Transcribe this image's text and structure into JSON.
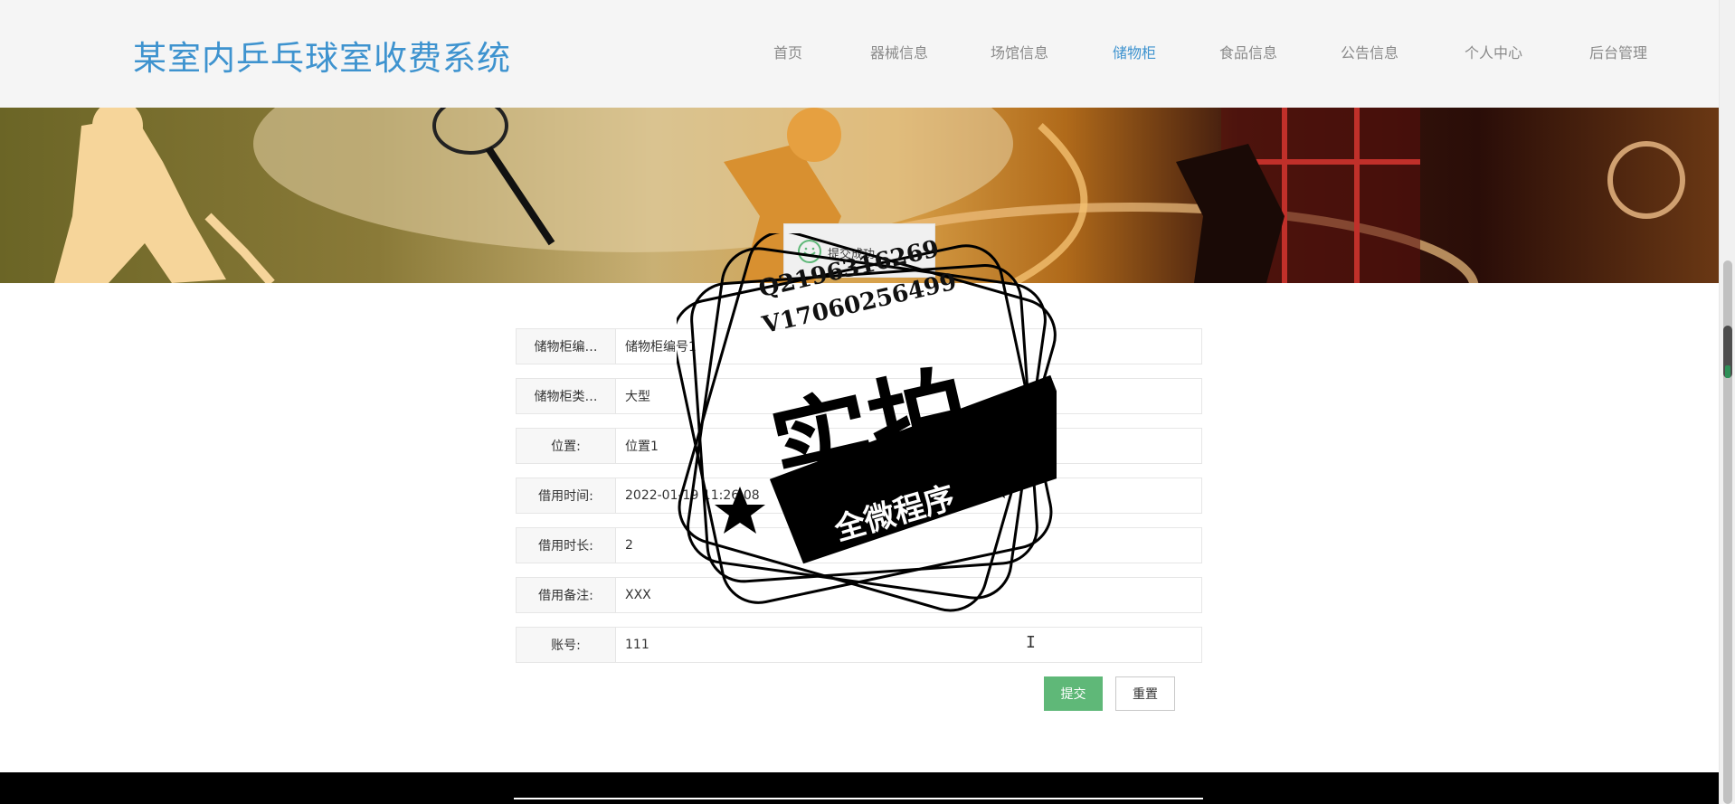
{
  "header": {
    "site_title": "某室内乒乓球室收费系统",
    "nav": [
      {
        "label": "首页"
      },
      {
        "label": "器械信息"
      },
      {
        "label": "场馆信息"
      },
      {
        "label": "储物柜"
      },
      {
        "label": "食品信息"
      },
      {
        "label": "公告信息"
      },
      {
        "label": "个人中心"
      },
      {
        "label": "后台管理"
      }
    ],
    "active_nav": "储物柜"
  },
  "toast": {
    "message": "提交成功"
  },
  "form": {
    "fields": [
      {
        "label": "储物柜编…",
        "value": "储物柜编号1"
      },
      {
        "label": "储物柜类…",
        "value": "大型"
      },
      {
        "label": "位置:",
        "value": "位置1"
      },
      {
        "label": "借用时间:",
        "value": "2022-01-19 11:26:08"
      },
      {
        "label": "借用时长:",
        "value": "2"
      },
      {
        "label": "借用备注:",
        "value": "XXX"
      },
      {
        "label": "账号:",
        "value": "111"
      }
    ],
    "submit_label": "提交",
    "reset_label": "重置"
  },
  "watermark": {
    "line1": "Q2196316269",
    "line2": "V17060256499",
    "big": "实拍",
    "ribbon": "全微程序"
  },
  "colors": {
    "brand": "#3e93cf",
    "submit": "#5fb878",
    "nav_inactive": "#8a8a8a"
  }
}
